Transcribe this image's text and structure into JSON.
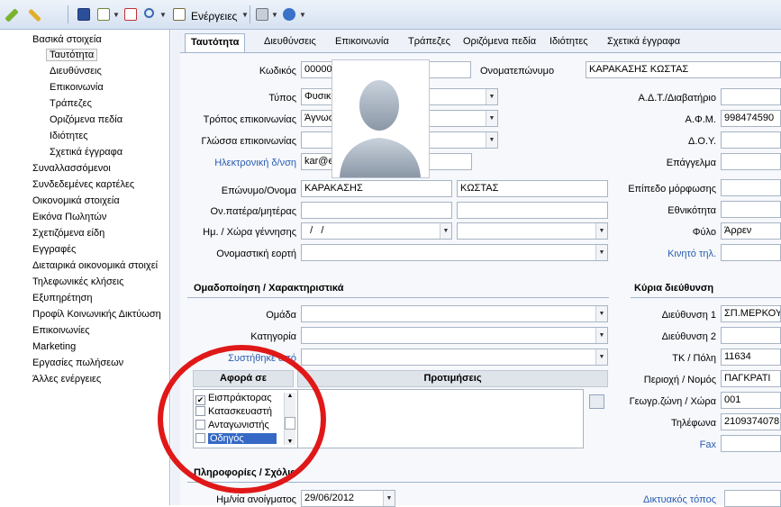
{
  "toolbar": {
    "energeies_label": "Ενέργειες"
  },
  "sidebar": {
    "items": [
      {
        "label": "Βασικά στοιχεία",
        "level": 0
      },
      {
        "label": "Ταυτότητα",
        "level": 1,
        "selected": true
      },
      {
        "label": "Διευθύνσεις",
        "level": 1
      },
      {
        "label": "Επικοινωνία",
        "level": 1
      },
      {
        "label": "Τράπεζες",
        "level": 1
      },
      {
        "label": "Οριζόμενα πεδία",
        "level": 1
      },
      {
        "label": "Ιδιότητες",
        "level": 1
      },
      {
        "label": "Σχετικά έγγραφα",
        "level": 1
      },
      {
        "label": "Συναλλασσόμενοι",
        "level": 0
      },
      {
        "label": "Συνδεδεμένες καρτέλες",
        "level": 0
      },
      {
        "label": "Οικονομικά στοιχεία",
        "level": 0
      },
      {
        "label": "Εικόνα Πωλητών",
        "level": 0
      },
      {
        "label": "Σχετιζόμενα είδη",
        "level": 0
      },
      {
        "label": "Εγγραφές",
        "level": 0
      },
      {
        "label": "Διεταιρικά οικονομικά στοιχεί",
        "level": 0
      },
      {
        "label": "Τηλεφωνικές κλήσεις",
        "level": 0
      },
      {
        "label": "Εξυπηρέτηση",
        "level": 0
      },
      {
        "label": "Προφίλ Κοινωνικής Δικτύωση",
        "level": 0
      },
      {
        "label": "Επικοινωνίες",
        "level": 0
      },
      {
        "label": "Marketing",
        "level": 0
      },
      {
        "label": "Εργασίες πωλήσεων",
        "level": 0
      },
      {
        "label": "Άλλες ενέργειες",
        "level": 0
      }
    ]
  },
  "tabs": [
    "Ταυτότητα",
    "Διευθύνσεις",
    "Επικοινωνία",
    "Τράπεζες",
    "Οριζόμενα πεδία",
    "Ιδιότητες",
    "Σχετικά έγγραφα"
  ],
  "form": {
    "kodikos": {
      "label": "Κωδικός",
      "value": "0000090"
    },
    "onomateponymo": {
      "label": "Ονοματεπώνυμο",
      "value": "ΚΑΡΑΚΑΣΗΣ ΚΩΣΤΑΣ"
    },
    "typos": {
      "label": "Τύπος",
      "value": "Φυσικό πρόσωπο"
    },
    "tropos": {
      "label": "Τρόπος επικοινωνίας",
      "value": "Άγνωστο"
    },
    "glossa": {
      "label": "Γλώσσα επικοινωνίας",
      "value": ""
    },
    "email": {
      "label": "Ηλεκτρονική δ/νση",
      "value": "kar@entersoft.gr"
    },
    "eponymo_onoma": {
      "label": "Επώνυμο/Ονομα",
      "value1": "ΚΑΡΑΚΑΣΗΣ",
      "value2": "ΚΩΣΤΑΣ"
    },
    "onomata_goneon": {
      "label": "Ον.πατέρα/μητέρας"
    },
    "gennisi": {
      "label": "Ημ. / Χώρα γέννησης",
      "value": "  /   /"
    },
    "eorti": {
      "label": "Ονομαστική εορτή"
    },
    "adt": {
      "label": "Α.Δ.Τ./Διαβατήριο",
      "value": ""
    },
    "afm": {
      "label": "Α.Φ.Μ.",
      "value": "998474590"
    },
    "doy": {
      "label": "Δ.Ο.Υ.",
      "value": ""
    },
    "epaggelma": {
      "label": "Επάγγελμα",
      "value": ""
    },
    "morfosi": {
      "label": "Επίπεδο μόρφωσης",
      "value": ""
    },
    "ethnikotita": {
      "label": "Εθνικότητα",
      "value": ""
    },
    "fylo": {
      "label": "Φύλο",
      "value": "Άρρεν"
    },
    "kinito": {
      "label": "Κινητό τηλ.",
      "value": ""
    }
  },
  "group_section": {
    "title": "Ομαδοποίηση / Χαρακτηριστικά",
    "omada": "Ομάδα",
    "katigoria": "Κατηγορία",
    "systithike": "Συστήθηκε από"
  },
  "afora": {
    "header": "Αφορά σε",
    "items": [
      {
        "label": "Εισπράκτορας",
        "checked": true,
        "highlight": false
      },
      {
        "label": "Κατασκευαστή",
        "checked": false,
        "highlight": false
      },
      {
        "label": "Ανταγωνιστής",
        "checked": false,
        "highlight": false
      },
      {
        "label": "Οδηγός",
        "checked": false,
        "highlight": true
      }
    ]
  },
  "protimiseis": {
    "header": "Προτιμήσεις"
  },
  "address": {
    "title": "Κύρια διεύθυνση",
    "d1": {
      "label": "Διεύθυνση 1",
      "value": "ΣΠ.ΜΕΡΚΟΥ"
    },
    "d2": {
      "label": "Διεύθυνση 2",
      "value": ""
    },
    "tk": {
      "label": "ΤΚ / Πόλη",
      "value": "11634"
    },
    "perioxi": {
      "label": "Περιοχή / Νομός",
      "value": "ΠΑΓΚΡΑΤΙ"
    },
    "geo": {
      "label": "Γεωγρ.ζώνη / Χώρα",
      "value": "001"
    },
    "tel": {
      "label": "Τηλέφωνα",
      "value": "2109374078"
    },
    "fax": {
      "label": "Fax",
      "value": ""
    }
  },
  "info": {
    "title": "Πληροφορίες / Σχόλια",
    "opening": {
      "label": "Ημ/νία ανοίγματος",
      "value": "29/06/2012"
    },
    "website": {
      "label": "Δικτυακός τόπος",
      "value": ""
    }
  },
  "colors": {
    "highlight_circle": "#e01818",
    "selection": "#3569c5",
    "link_label": "#2a5db0"
  }
}
